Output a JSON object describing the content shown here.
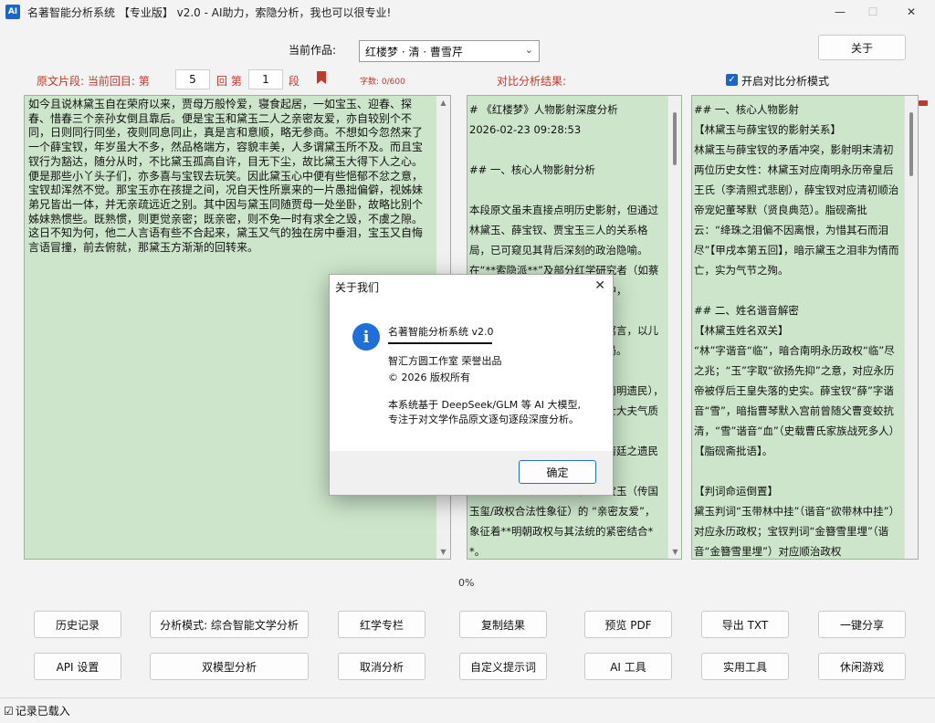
{
  "window": {
    "app_icon_text": "AI",
    "title": "名著智能分析系统 【专业版】 v2.0 - AI助力，索隐分析，我也可以很专业!",
    "min_glyph": "—",
    "max_glyph": "☐",
    "close_glyph": "✕"
  },
  "top": {
    "work_label": "当前作品:",
    "work_value": "红楼梦 · 清 · 曹雪芹",
    "dropdown_glyph": "⌄",
    "about_label": "关于"
  },
  "segment": {
    "label": "原文片段: 当前回目: 第",
    "chapter": "5",
    "chapter_suffix": "回 第",
    "paragraph": "1",
    "paragraph_suffix": "段",
    "char_count": "字数: 0/600",
    "compare_label": "对比分析结果:",
    "compare_mode_label": "开启对比分析模式",
    "compare_mode_checked": "✓"
  },
  "panes": {
    "original": "如今且说林黛玉自在荣府以来，贾母万般怜爱，寝食起居，一如宝玉、迎春、探春、惜春三个亲孙女倒且靠后。便是宝玉和黛玉二人之亲密友爱，亦自较别个不同，日则同行同坐，夜则同息同止，真是言和意顺，略无参商。不想如今忽然来了一个薛宝钗，年岁虽大不多，然品格端方，容貌丰美，人多谓黛玉所不及。而且宝钗行为豁达，随分从时，不比黛玉孤高自许，目无下尘，故比黛玉大得下人之心。便是那些小丫头子们，亦多喜与宝钗去玩笑。因此黛玉心中便有些悒郁不忿之意，宝钗却浑然不觉。那宝玉亦在孩提之间，况自天性所禀来的一片愚拙偏僻，视姊妹弟兄皆出一体，并无亲疏远近之别。其中因与黛玉同随贾母一处坐卧，故略比别个姊妹熟惯些。既熟惯，则更觉亲密；既亲密，则不免一时有求全之毁，不虞之隙。这日不知为何，他二人言语有些不合起来，黛玉又气的独在房中垂泪，宝玉又自悔言语冒撞，前去俯就，那黛玉方渐渐的回转来。",
    "analysis": "# 《红楼梦》人物影射深度分析\n2026-02-23 09:28:53\n\n## 一、核心人物影射分析\n\n本段原文虽未直接点明历史影射，但通过林黛玉、薛宝钗、贾宝玉三人的关系格局，已可窥见其背后深刻的政治隐喻。在“**索隐派**”及部分红学研究者（如蔡元培、潘重规等）的解读体系中，\n\n此段实为明清易代时期的政治寓言，以儿女情长映射王朝更替的历史变局。\n\n**林黛玉**：影射南明朝（或南明遗民），孤高自许，目无下尘，其文官士大夫气质与清廷格格不入，不合时宜\n**薛宝钗**：影射清廷或归顺清廷之遗民而对江南士人之收买\n**宝玉与宝钗之金玉良缘**：宝玉（传国玉玺/政权合法性象征）的 “亲密友爱”，象征着**明朝政权与其法统的紧密结合**。\n\n**薛宝钗**：笼络人心，“清朝（或新兴政权）”之象征",
    "compare": "## 一、核心人物影射\n【林黛玉与薛宝钗的影射关系】\n林黛玉与薛宝钗的矛盾冲突，影射明末清初两位历史女性：林黛玉对应南明永历帝皇后王氏（李清照式悲剧），薛宝钗对应清初顺治帝宠妃董琴默（贤良典范）。脂砚斋批云：“绛珠之泪偏不因离恨，为惜其石而泪尽”【甲戌本第五回】，暗示黛玉之泪非为情而亡，实为气节之殉。\n\n## 二、姓名谐音解密\n【林黛玉姓名双关】\n“林”字谐音“临”，暗合南明永历政权“临”尽之兆；“玉”字取“欲扬先抑”之意，对应永历帝被俘后王皇失落的史实。薛宝钗“薛”字谐音“雪”，暗指曹琴默入宫前曾随父曹变蛟抗清，“雪”谐音“血”（史载曹氏家族战死多人）【脂砚斋批语】。\n\n【判词命运倒置】\n黛玉判词“玉带林中挂”（谐音“欲带林中挂”）对应永历政权；宝钗判词“金簪雪里埋”（谐音“金簪雪里埋”）对应顺治政权"
  },
  "progress": {
    "value": 0,
    "text": "0%"
  },
  "buttons": {
    "history": "历史记录",
    "analysis_mode": "分析模式: 综合智能文学分析",
    "redology": "红学专栏",
    "copy_result": "复制结果",
    "preview_pdf": "预览 PDF",
    "export_txt": "导出 TXT",
    "share": "一键分享",
    "api_settings": "API 设置",
    "dual_model": "双模型分析",
    "cancel_analysis": "取消分析",
    "custom_prompt": "自定义提示词",
    "ai_tools": "AI 工具",
    "utilities": "实用工具",
    "games": "休闲游戏"
  },
  "status": {
    "icon": "☑",
    "text": "记录已载入"
  },
  "modal": {
    "title": "关于我们",
    "close_glyph": "✕",
    "info_glyph": "i",
    "app_name": "名著智能分析系统 v2.0",
    "studio": "智汇方圆工作室 荣誉出品",
    "copyright": "© 2026 版权所有",
    "desc1": "本系统基于 DeepSeek/GLM 等 AI 大模型,",
    "desc2": "专注于对文学作品原文逐句逐段深度分析。",
    "ok_label": "确定"
  },
  "colors": {
    "pane_bg": "#cde6cb",
    "accent_red": "#c0392b",
    "accent_blue": "#1e64c8"
  }
}
